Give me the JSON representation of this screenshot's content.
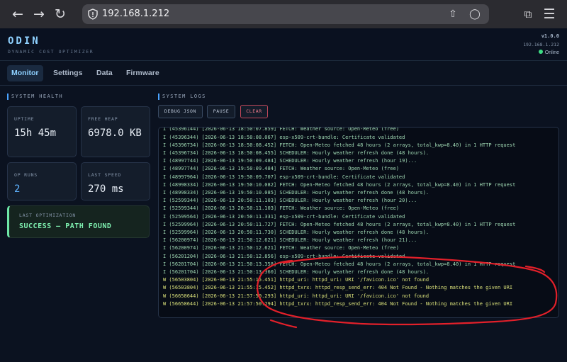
{
  "browser": {
    "url": "192.168.1.212",
    "icons": [
      "back-arrow-icon",
      "forward-arrow-icon",
      "reload-icon",
      "shield-icon",
      "share-icon",
      "add-note-icon",
      "tabs-icon",
      "menu-icon"
    ]
  },
  "header": {
    "brand": "ODIN",
    "subtitle": "DYNAMIC COST OPTIMIZER",
    "version": "v1.0.0",
    "ip": "192.168.1.212",
    "status": "Online",
    "status_color": "#3ddc84"
  },
  "tabs": [
    {
      "label": "Monitor",
      "active": true
    },
    {
      "label": "Settings",
      "active": false
    },
    {
      "label": "Data",
      "active": false
    },
    {
      "label": "Firmware",
      "active": false
    }
  ],
  "health": {
    "title": "SYSTEM HEALTH",
    "cards": [
      {
        "label": "UPTIME",
        "value": "15h 45m"
      },
      {
        "label": "FREE HEAP",
        "value": "6978.0 KB"
      },
      {
        "label": "OP RUNS",
        "value": "2"
      },
      {
        "label": "LAST SPEED",
        "value": "270 ms"
      }
    ],
    "last_optimization": {
      "label": "LAST OPTIMIZATION",
      "value": "SUCCESS — PATH FOUND"
    }
  },
  "logs": {
    "title": "SYSTEM LOGS",
    "buttons": {
      "debug": "DEBUG JSON",
      "pause": "PAUSE",
      "clear": "CLEAR"
    },
    "lines": [
      {
        "text": "I (45396144) [2026-06-13 18:50:07.859] FETCH: Weather source: Open-Meteo (free)",
        "level": "I"
      },
      {
        "text": "I (45396344) [2026-06-13 18:50:08.067] esp-x509-crt-bundle: Certificate validated",
        "level": "I"
      },
      {
        "text": "I (45396734) [2026-06-13 18:50:08.452] FETCH: Open-Meteo fetched 48 hours (2 arrays, total_kwp=8.40) in 1 HTTP request",
        "level": "I"
      },
      {
        "text": "I (45396734) [2026-06-13 18:50:08.455] SCHEDULER: Hourly weather refresh done (48 hours).",
        "level": "I"
      },
      {
        "text": "I (48997744) [2026-06-13 19:50:09.484] SCHEDULER: Hourly weather refresh (hour 19)...",
        "level": "I"
      },
      {
        "text": "I (48997744) [2026-06-13 19:50:09.484] FETCH: Weather source: Open-Meteo (free)",
        "level": "I"
      },
      {
        "text": "I (48997964) [2026-06-13 19:50:09.707] esp-x509-crt-bundle: Certificate validated",
        "level": "I"
      },
      {
        "text": "I (48998334) [2026-06-13 19:50:10.082] FETCH: Open-Meteo fetched 48 hours (2 arrays, total_kwp=8.40) in 1 HTTP request",
        "level": "I"
      },
      {
        "text": "I (48998334) [2026-06-13 19:50:10.085] SCHEDULER: Hourly weather refresh done (48 hours).",
        "level": "I"
      },
      {
        "text": "I (52599344) [2026-06-13 20:50:11.103] SCHEDULER: Hourly weather refresh (hour 20)...",
        "level": "I"
      },
      {
        "text": "I (52599344) [2026-06-13 20:50:11.103] FETCH: Weather source: Open-Meteo (free)",
        "level": "I"
      },
      {
        "text": "I (52599564) [2026-06-13 20:50:11.331] esp-x509-crt-bundle: Certificate validated",
        "level": "I"
      },
      {
        "text": "I (52599964) [2026-06-13 20:50:11.727] FETCH: Open-Meteo fetched 48 hours (2 arrays, total_kwp=8.40) in 1 HTTP request",
        "level": "I"
      },
      {
        "text": "I (52599964) [2026-06-13 20:50:11.730] SCHEDULER: Hourly weather refresh done (48 hours).",
        "level": "I"
      },
      {
        "text": "I (56200974) [2026-06-13 21:50:12.621] SCHEDULER: Hourly weather refresh (hour 21)...",
        "level": "I"
      },
      {
        "text": "I (56200974) [2026-06-13 21:50:12.621] FETCH: Weather source: Open-Meteo (free)",
        "level": "I"
      },
      {
        "text": "I (56201204) [2026-06-13 21:50:12.856] esp-x509-crt-bundle: Certificate validated",
        "level": "I"
      },
      {
        "text": "I (56201704) [2026-06-13 21:50:13.358] FETCH: Open-Meteo fetched 48 hours (2 arrays, total_kwp=8.40) in 1 HTTP request",
        "level": "I"
      },
      {
        "text": "I (56201704) [2026-06-13 21:50:13.360] SCHEDULER: Hourly weather refresh done (48 hours).",
        "level": "I"
      },
      {
        "text": "W (56503804) [2026-06-13 21:55:15.451] httpd_uri: httpd_uri: URI '/favicon.ico' not found",
        "level": "W"
      },
      {
        "text": "W (56503804) [2026-06-13 21:55:15.452] httpd_txrx: httpd_resp_send_err: 404 Not Found - Nothing matches the given URI",
        "level": "W"
      },
      {
        "text": "W (56658644) [2026-06-13 21:57:50.293] httpd_uri: httpd_uri: URI '/favicon.ico' not found",
        "level": "W"
      },
      {
        "text": "W (56658644) [2026-06-13 21:57:50.294] httpd_txrx: httpd_resp_send_err: 404 Not Found - Nothing matches the given URI",
        "level": "W"
      }
    ],
    "colors": {
      "info": "#9fd8b3",
      "warn": "#d9e07a"
    }
  },
  "annotation_color": "#e3202a"
}
